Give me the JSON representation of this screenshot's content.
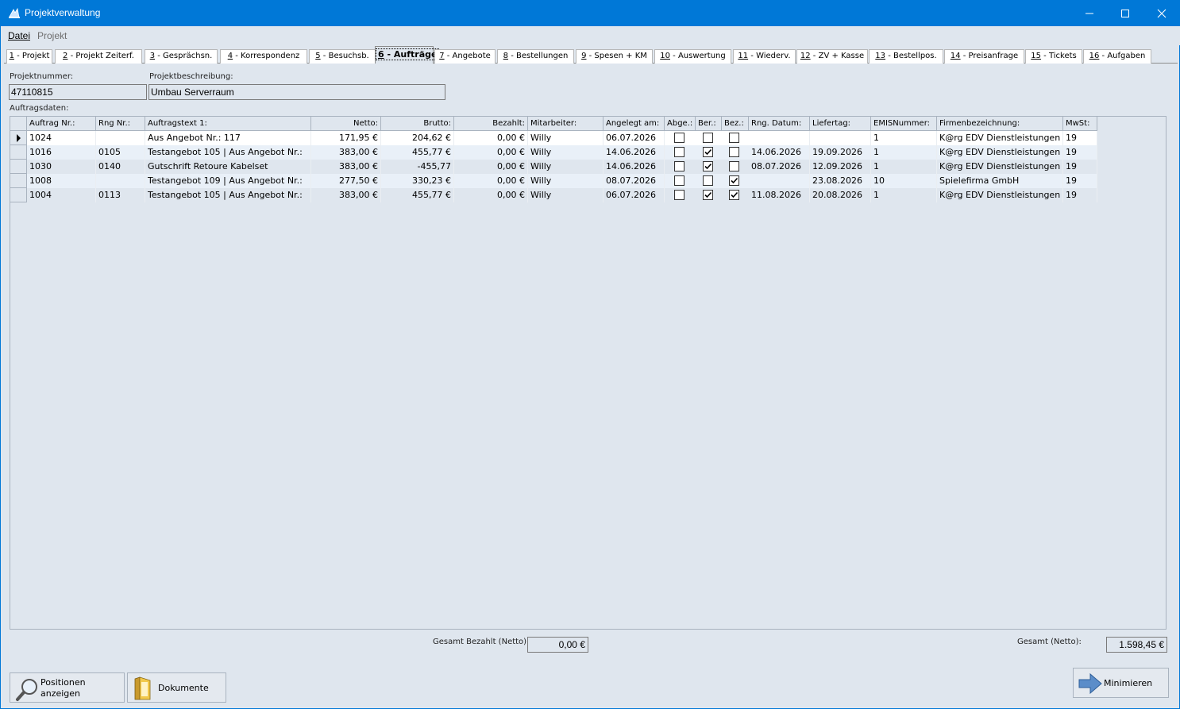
{
  "window": {
    "title": "Projektverwaltung"
  },
  "menu": [
    {
      "label": "Datei",
      "enabled": true
    },
    {
      "label": "Projekt",
      "enabled": false
    }
  ],
  "tabs": [
    {
      "num": "1",
      "text": " - Projekt"
    },
    {
      "num": "2",
      "text": " - Projekt Zeiterf."
    },
    {
      "num": "3",
      "text": " - Gesprächsn."
    },
    {
      "num": "4",
      "text": " - Korrespondenz"
    },
    {
      "num": "5",
      "text": " - Besuchsb."
    },
    {
      "num": "6",
      "text": " - Aufträge"
    },
    {
      "num": "7",
      "text": " - Angebote"
    },
    {
      "num": "8",
      "text": " - Bestellungen"
    },
    {
      "num": "9",
      "text": " - Spesen + KM"
    },
    {
      "num": "10",
      "text": " - Auswertung"
    },
    {
      "num": "11",
      "text": " - Wiederv."
    },
    {
      "num": "12",
      "text": " - ZV + Kasse"
    },
    {
      "num": "13",
      "text": " - Bestellpos."
    },
    {
      "num": "14",
      "text": " - Preisanfrage"
    },
    {
      "num": "15",
      "text": " - Tickets"
    },
    {
      "num": "16",
      "text": " - Aufgaben"
    }
  ],
  "project": {
    "nummer_label": "Projektnummer:",
    "nummer": "47110815",
    "beschreibung_label": "Projektbeschreibung:",
    "beschreibung": "Umbau Serverraum",
    "section_label": "Auftragsdaten:"
  },
  "grid": {
    "columns": [
      "Auftrag Nr.:",
      "Rng Nr.:",
      "Auftragstext 1:",
      "Netto:",
      "Brutto:",
      "Bezahlt:",
      "Mitarbeiter:",
      "Angelegt am:",
      "Abge.:",
      "Ber.:",
      "Bez.:",
      "Rng. Datum:",
      "Liefertag:",
      "EMISNummer:",
      "Firmenbezeichnung:",
      "MwSt:"
    ],
    "rows": [
      {
        "auftrag": "1024",
        "rng": "",
        "text": "Aus Angebot Nr.: 117",
        "netto": "171,95 €",
        "brutto": "204,62 €",
        "bezahlt": "0,00 €",
        "mitarbeiter": "Willy",
        "angelegt": "06.07.2026",
        "abge": false,
        "ber": false,
        "bez": false,
        "rngdatum": "",
        "liefertag": "",
        "emis": "1",
        "firma": "K@rg EDV Dienstleistungen",
        "mwst": "19"
      },
      {
        "auftrag": "1016",
        "rng": "0105",
        "text": "Testangebot 105 | Aus Angebot Nr.:",
        "netto": "383,00 €",
        "brutto": "455,77 €",
        "bezahlt": "0,00 €",
        "mitarbeiter": "Willy",
        "angelegt": "14.06.2026",
        "abge": false,
        "ber": true,
        "bez": false,
        "rngdatum": "14.06.2026",
        "liefertag": "19.09.2026",
        "emis": "1",
        "firma": "K@rg EDV Dienstleistungen",
        "mwst": "19"
      },
      {
        "auftrag": "1030",
        "rng": "0140",
        "text": "Gutschrift Retoure Kabelset",
        "netto": "383,00 €",
        "brutto": "-455,77",
        "bezahlt": "0,00 €",
        "mitarbeiter": "Willy",
        "angelegt": "14.06.2026",
        "abge": false,
        "ber": true,
        "bez": false,
        "rngdatum": "08.07.2026",
        "liefertag": "12.09.2026",
        "emis": "1",
        "firma": "K@rg EDV Dienstleistungen",
        "mwst": "19"
      },
      {
        "auftrag": "1008",
        "rng": "",
        "text": "Testangebot 109 | Aus Angebot Nr.:",
        "netto": "277,50 €",
        "brutto": "330,23 €",
        "bezahlt": "0,00 €",
        "mitarbeiter": "Willy",
        "angelegt": "08.07.2026",
        "abge": false,
        "ber": false,
        "bez": true,
        "rngdatum": "",
        "liefertag": "23.08.2026",
        "emis": "10",
        "firma": "Spielefirma GmbH",
        "mwst": "19"
      },
      {
        "auftrag": "1004",
        "rng": "0113",
        "text": "Testangebot 105 | Aus Angebot Nr.:",
        "netto": "383,00 €",
        "brutto": "455,77 €",
        "bezahlt": "0,00 €",
        "mitarbeiter": "Willy",
        "angelegt": "06.07.2026",
        "abge": false,
        "ber": true,
        "bez": true,
        "rngdatum": "11.08.2026",
        "liefertag": "20.08.2026",
        "emis": "1",
        "firma": "K@rg EDV Dienstleistungen",
        "mwst": "19"
      }
    ]
  },
  "summary": {
    "bezahlt_label": "Gesamt Bezahlt (Netto):",
    "bezahlt_value": "0,00 €",
    "gesamt_label": "Gesamt (Netto):",
    "gesamt_value": "1.598,45 €"
  },
  "buttons": {
    "positionen_line1": "Positionen",
    "positionen_line2": "anzeigen",
    "dokumente": "Dokumente",
    "minimieren": "Minimieren"
  }
}
